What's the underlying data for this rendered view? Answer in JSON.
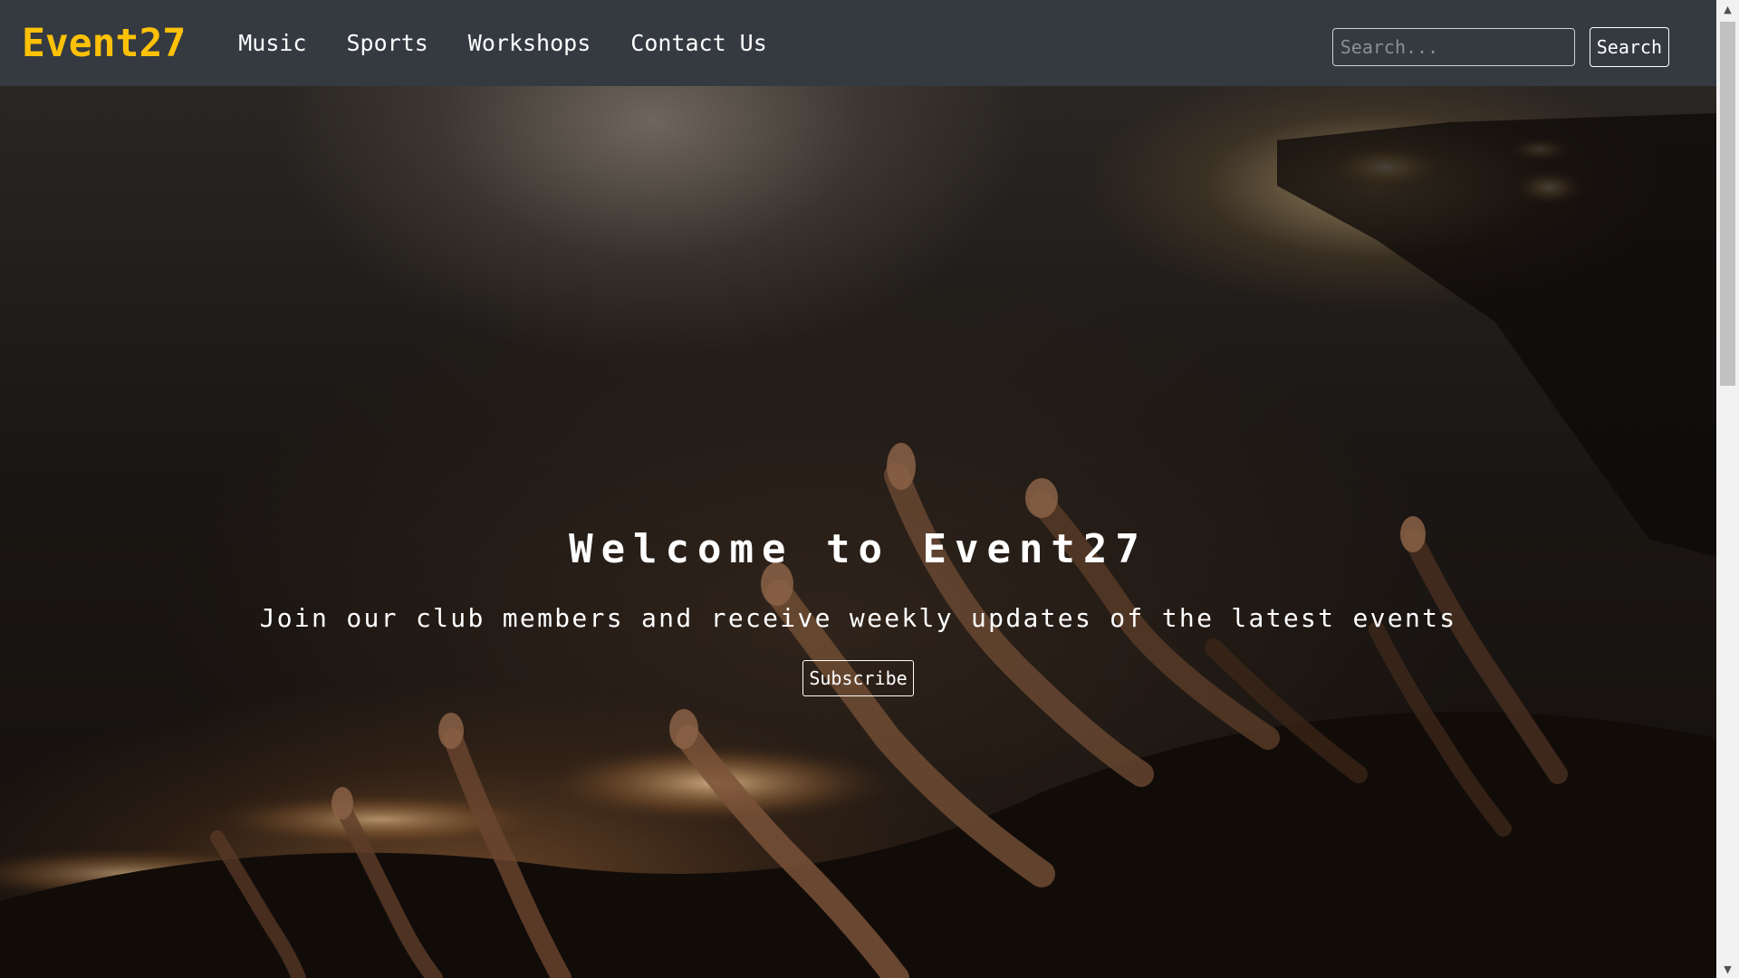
{
  "navbar": {
    "brand": "Event27",
    "links": [
      {
        "label": "Music"
      },
      {
        "label": "Sports"
      },
      {
        "label": "Workshops"
      },
      {
        "label": "Contact Us"
      }
    ],
    "search": {
      "placeholder": "Search...",
      "value": "",
      "button_label": "Search"
    }
  },
  "hero": {
    "title": "Welcome to Event27",
    "subtitle": "Join our club members and receive weekly updates of the latest events",
    "button_label": "Subscribe",
    "background_image": "concert-crowd-raised-hands"
  },
  "scrollbar": {
    "up_icon": "scroll-up-arrow-icon",
    "down_icon": "scroll-down-arrow-icon"
  },
  "colors": {
    "navbar_bg": "#343a40",
    "brand": "#ffc107",
    "text": "#ffffff"
  }
}
